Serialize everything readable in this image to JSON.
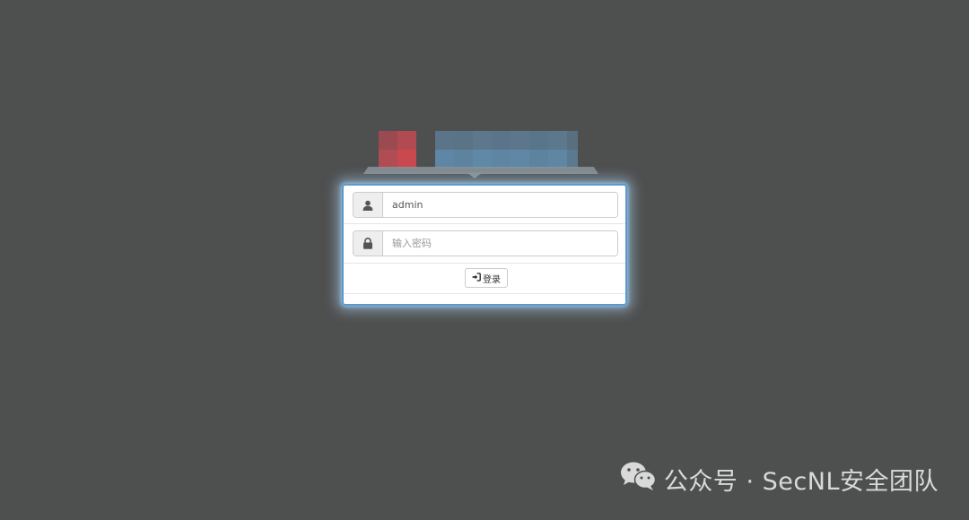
{
  "login": {
    "username": {
      "value": "admin",
      "icon": "user-icon"
    },
    "password": {
      "placeholder": "输入密码",
      "icon": "lock-icon"
    },
    "submit": {
      "label": "登录",
      "icon": "sign-in-icon"
    }
  },
  "watermark": {
    "text": "公众号 · SecNL安全团队",
    "icon": "wechat-icon"
  },
  "colors": {
    "background": "#4e4f4f",
    "panel_border": "#5b9ad0",
    "logo_red": "#c7484d",
    "logo_blue": "#5d87a6"
  }
}
